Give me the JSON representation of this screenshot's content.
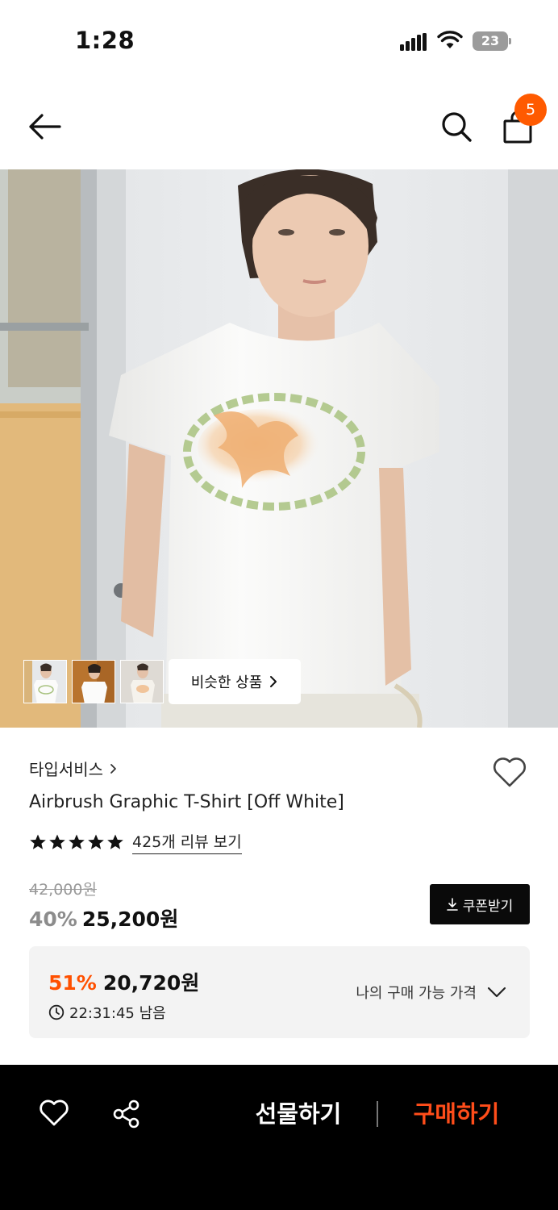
{
  "status_bar": {
    "time": "1:28",
    "battery": "23"
  },
  "header": {
    "cart_count": "5"
  },
  "gallery": {
    "similar_label": "비슷한 상품"
  },
  "product": {
    "brand": "타입서비스",
    "title": "Airbrush Graphic T-Shirt [Off White]",
    "rating_stars": 5,
    "review_link": "425개 리뷰 보기",
    "original_price": "42,000원",
    "discount_percent": "40%",
    "sale_price": "25,200원",
    "coupon_label": "쿠폰받기"
  },
  "best_price": {
    "percent": "51%",
    "price": "20,720원",
    "time_left": "22:31:45 남음",
    "my_price_label": "나의 구매 가능 가격"
  },
  "bottom_bar": {
    "gift_label": "선물하기",
    "buy_label": "구매하기"
  },
  "colors": {
    "accent": "#ff5a00",
    "buy": "#ff4d1a",
    "dark": "#000000"
  }
}
